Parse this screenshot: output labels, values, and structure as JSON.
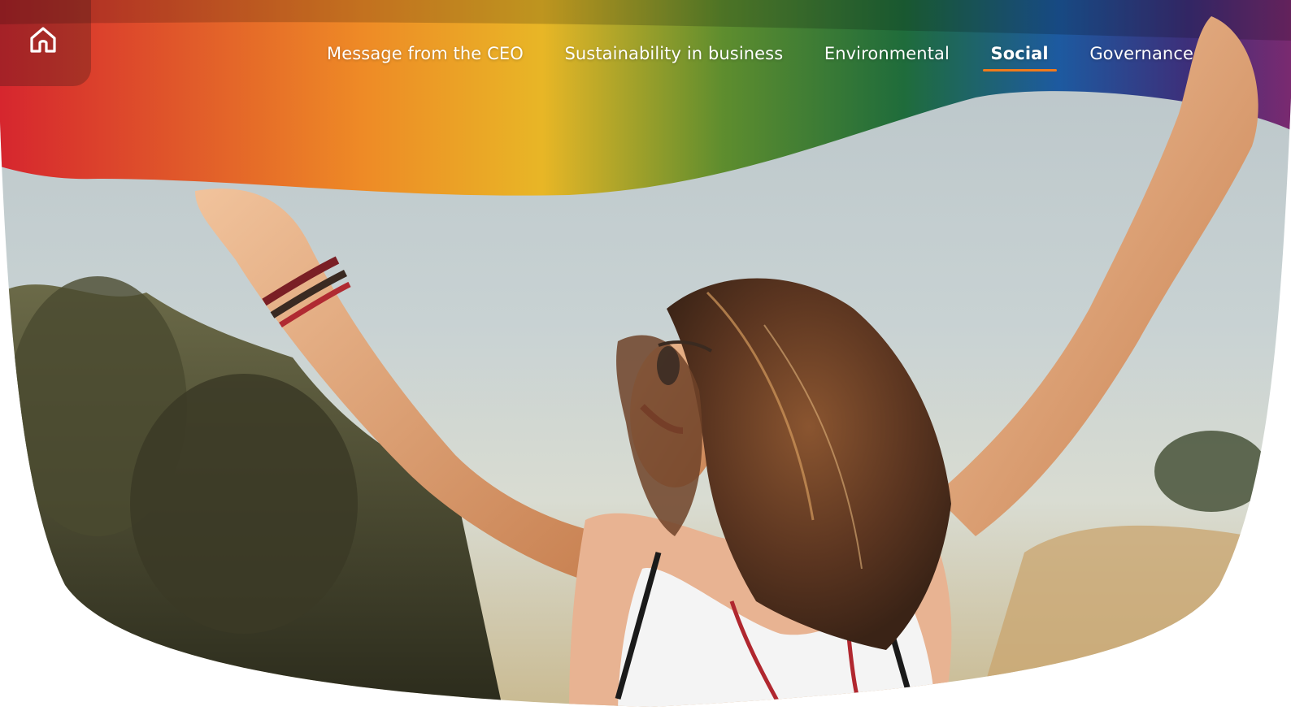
{
  "home": {
    "icon": "home-icon"
  },
  "nav": {
    "items": [
      {
        "label": "Message from the CEO",
        "active": false
      },
      {
        "label": "Sustainability in business",
        "active": false
      },
      {
        "label": "Environmental",
        "active": false
      },
      {
        "label": "Social",
        "active": true
      },
      {
        "label": "Governance",
        "active": false
      }
    ]
  },
  "hero": {
    "image": "woman-waving-rainbow-flag-photo"
  },
  "colors": {
    "accent": "#f07a1c",
    "nav_text": "#ffffff",
    "background": "#ffffff"
  }
}
